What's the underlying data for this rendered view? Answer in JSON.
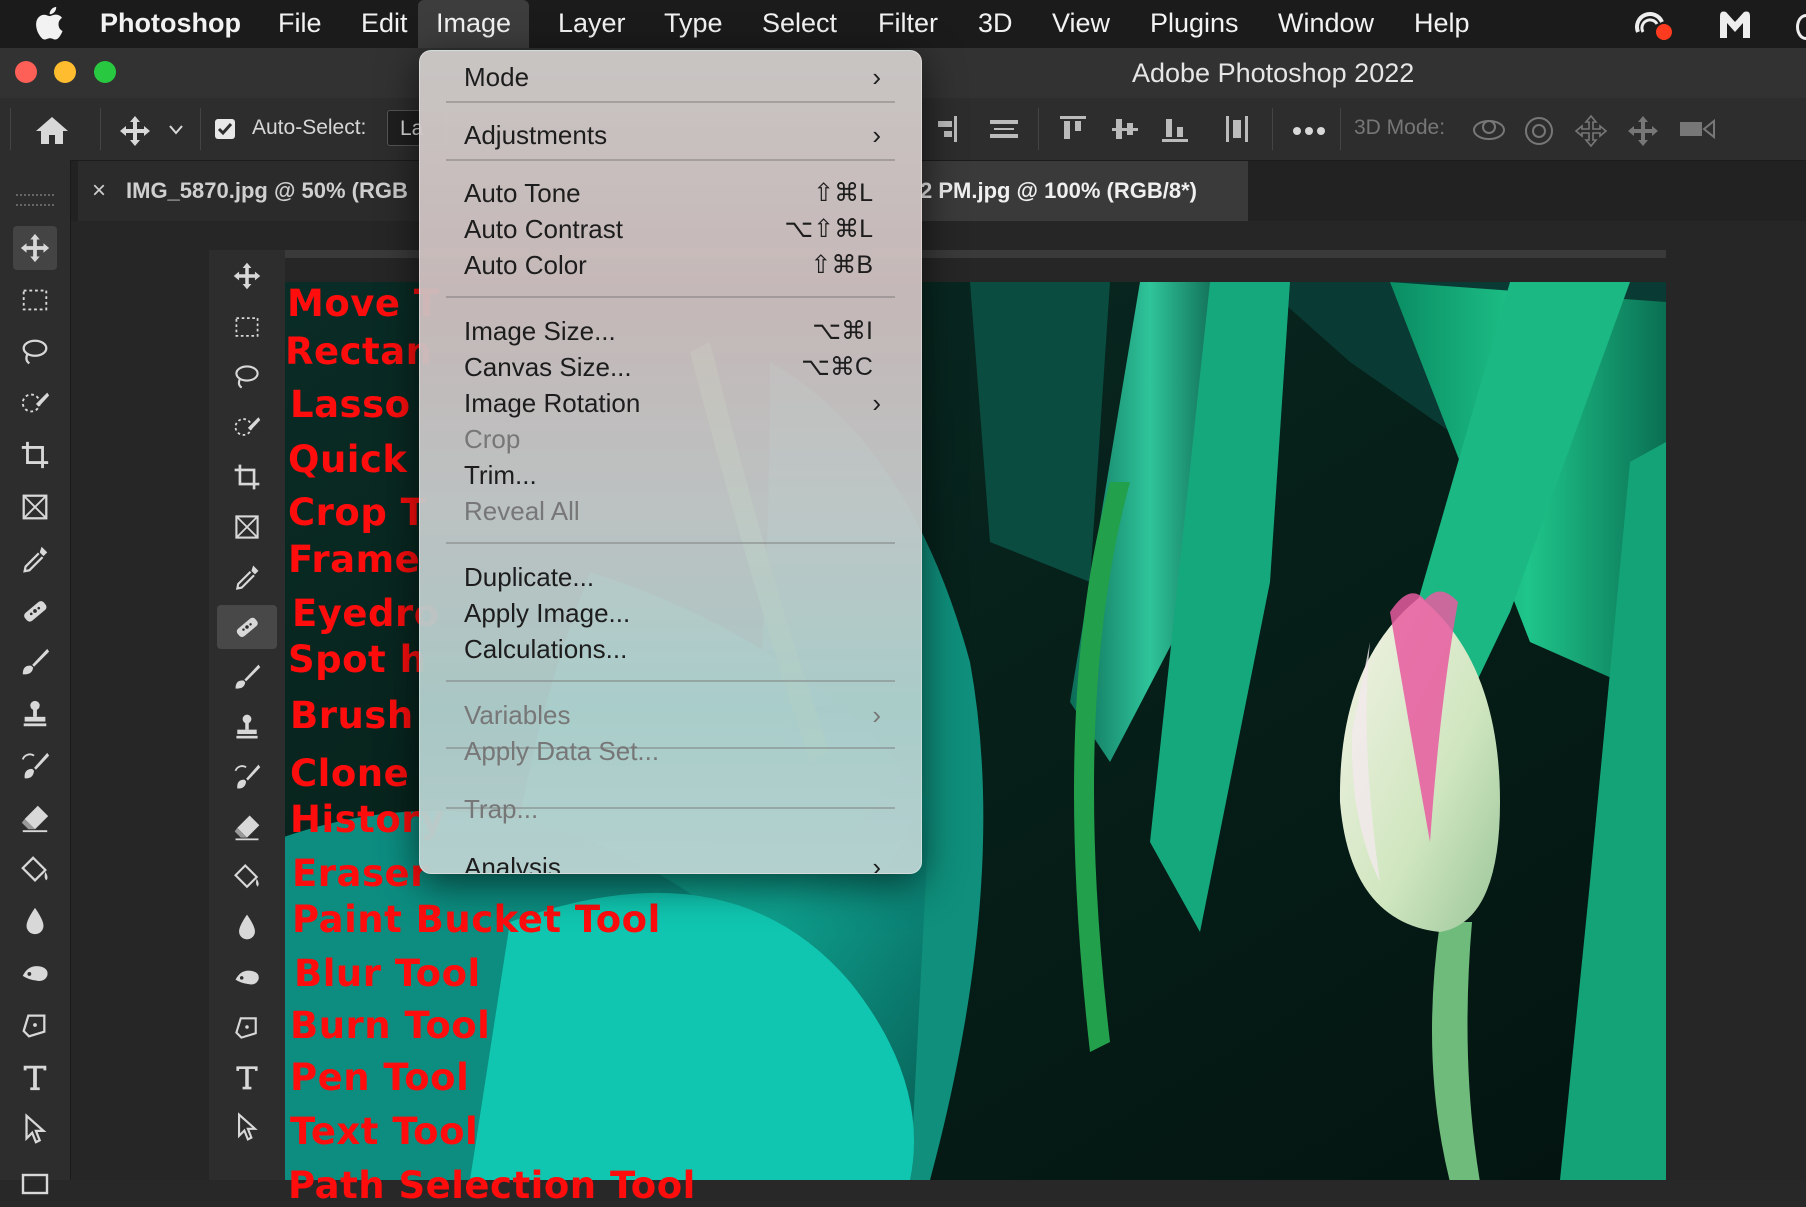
{
  "menubar": {
    "app": "Photoshop",
    "items": [
      "File",
      "Edit",
      "Image",
      "Layer",
      "Type",
      "Select",
      "Filter",
      "3D",
      "View",
      "Plugins",
      "Window",
      "Help"
    ],
    "active": "Image"
  },
  "window": {
    "title": "Adobe Photoshop 2022"
  },
  "optionsbar": {
    "auto_select_label": "Auto-Select:",
    "auto_select_value": "La",
    "mode_3d_label": "3D Mode:"
  },
  "tabs": [
    {
      "label": "IMG_5870.jpg @ 50% (RGB",
      "close": "×"
    },
    {
      "label": "2 PM.jpg @ 100% (RGB/8*)"
    }
  ],
  "image_menu": {
    "items": [
      {
        "label": "Mode",
        "submenu": true
      },
      {
        "label": "Adjustments",
        "submenu": true
      },
      {
        "label": "Auto Tone",
        "shortcut": "⇧⌘L"
      },
      {
        "label": "Auto Contrast",
        "shortcut": "⌥⇧⌘L"
      },
      {
        "label": "Auto Color",
        "shortcut": "⇧⌘B"
      },
      {
        "label": "Image Size...",
        "shortcut": "⌥⌘I"
      },
      {
        "label": "Canvas Size...",
        "shortcut": "⌥⌘C"
      },
      {
        "label": "Image Rotation",
        "submenu": true
      },
      {
        "label": "Crop",
        "disabled": true
      },
      {
        "label": "Trim..."
      },
      {
        "label": "Reveal All",
        "disabled": true
      },
      {
        "label": "Duplicate..."
      },
      {
        "label": "Apply Image..."
      },
      {
        "label": "Calculations..."
      },
      {
        "label": "Variables",
        "submenu": true,
        "disabled": true
      },
      {
        "label": "Apply Data Set...",
        "disabled": true
      },
      {
        "label": "Trap...",
        "disabled": true
      },
      {
        "label": "Analysis",
        "submenu": true
      }
    ],
    "arrow": "›"
  },
  "tool_labels": [
    "Move T",
    "Rectan",
    "Lasso",
    "Quick",
    "Crop T",
    "Frame",
    "Eyedro",
    "Spot h",
    "Brush",
    "Clone",
    "History",
    "Eraser",
    "Paint Bucket Tool",
    "Blur Tool",
    "Burn Tool",
    "Pen Tool",
    "Text Tool",
    "Path Selection Tool"
  ],
  "tool_icons": [
    "move-icon",
    "rectangular-marquee-icon",
    "lasso-icon",
    "quick-selection-icon",
    "crop-icon",
    "frame-icon",
    "eyedropper-icon",
    "spot-healing-icon",
    "brush-icon",
    "clone-stamp-icon",
    "history-brush-icon",
    "eraser-icon",
    "paint-bucket-icon",
    "blur-icon",
    "burn-icon",
    "pen-icon",
    "type-icon",
    "path-selection-icon"
  ],
  "colors": {
    "label_red": "#ff0d0d",
    "menubar": "#1b1b1b",
    "panel": "#2d2d2d"
  }
}
